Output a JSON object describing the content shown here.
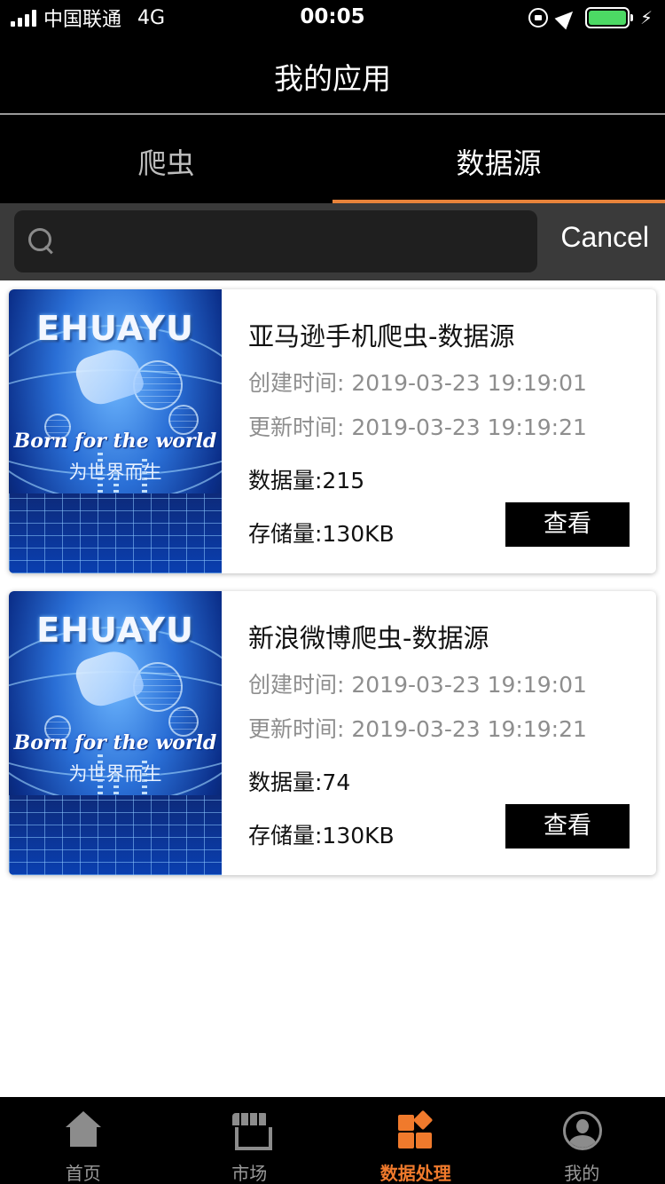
{
  "status_bar": {
    "carrier": "中国联通",
    "network": "4G",
    "time": "00:05",
    "battery_color": "#4cd964"
  },
  "header": {
    "title": "我的应用"
  },
  "tabs": [
    {
      "label": "爬虫",
      "active": false
    },
    {
      "label": "数据源",
      "active": true
    }
  ],
  "search": {
    "placeholder": "",
    "value": "",
    "cancel_label": "Cancel"
  },
  "thumbnail": {
    "brand": "EHUAYU",
    "tagline": "Born for the world",
    "tagline_cn": "为世界而生"
  },
  "cards": [
    {
      "title": "亚马逊手机爬虫-数据源",
      "created": "创建时间: 2019-03-23 19:19:01",
      "updated": "更新时间: 2019-03-23 19:19:21",
      "data_count": "数据量:215",
      "storage": "存储量:130KB",
      "button_label": "查看"
    },
    {
      "title": "新浪微博爬虫-数据源",
      "created": "创建时间: 2019-03-23 19:19:01",
      "updated": "更新时间: 2019-03-23 19:19:21",
      "data_count": "数据量:74",
      "storage": "存储量:130KB",
      "button_label": "查看"
    }
  ],
  "tabbar": [
    {
      "label": "首页",
      "icon": "home-icon",
      "active": false
    },
    {
      "label": "市场",
      "icon": "market-icon",
      "active": false
    },
    {
      "label": "数据处理",
      "icon": "data-processing-icon",
      "active": true
    },
    {
      "label": "我的",
      "icon": "profile-icon",
      "active": false
    }
  ],
  "colors": {
    "accent": "#f07a2c",
    "tab_indicator": "#e8833a",
    "bar_bg": "#000000"
  }
}
